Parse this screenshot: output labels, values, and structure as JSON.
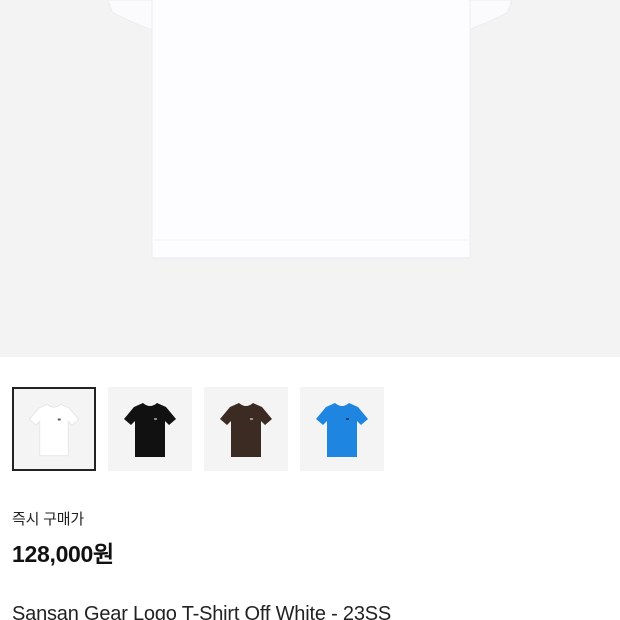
{
  "hero": {
    "image_name": "white-tshirt-main-image",
    "color": "#ffffff"
  },
  "thumbnails": [
    {
      "color_name": "Off White",
      "color": "#ffffff",
      "selected": true
    },
    {
      "color_name": "Black",
      "color": "#111111",
      "selected": false
    },
    {
      "color_name": "Brown",
      "color": "#3b2b22",
      "selected": false
    },
    {
      "color_name": "Blue",
      "color": "#1e86e0",
      "selected": false
    }
  ],
  "price": {
    "label": "즉시 구매가",
    "value": "128,000원"
  },
  "product": {
    "name": "Sansan Gear Logo T-Shirt Off White - 23SS"
  }
}
